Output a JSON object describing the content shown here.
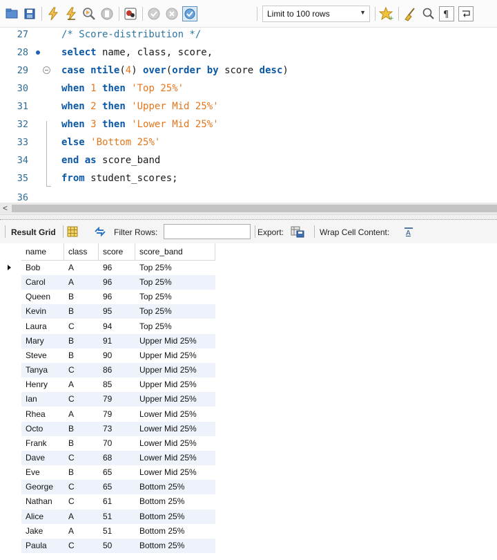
{
  "toolbar": {
    "limit_label": "Limit to 100 rows",
    "icons": [
      "open-folder-icon",
      "save-icon",
      "execute-icon",
      "execute-current-icon",
      "explain-icon",
      "stop-icon",
      "toggle-error-icon",
      "commit-icon",
      "rollback-icon",
      "autocommit-icon",
      "add-snippet-icon",
      "beautify-icon",
      "find-icon",
      "invisible-chars-icon",
      "wrap-icon"
    ]
  },
  "editor": {
    "lines": [
      {
        "num": "27",
        "breakpoint": false,
        "fold": false,
        "tokens": [
          {
            "t": "/* Score-distribution */",
            "c": "c"
          }
        ]
      },
      {
        "num": "28",
        "breakpoint": true,
        "fold": false,
        "tokens": [
          {
            "t": "select",
            "c": "k"
          },
          {
            "t": " name, class, score,",
            "c": "t"
          }
        ]
      },
      {
        "num": "29",
        "breakpoint": false,
        "fold": true,
        "tokens": [
          {
            "t": "case",
            "c": "k"
          },
          {
            "t": " ",
            "c": "t"
          },
          {
            "t": "ntile",
            "c": "k"
          },
          {
            "t": "(",
            "c": "t"
          },
          {
            "t": "4",
            "c": "o"
          },
          {
            "t": ") ",
            "c": "t"
          },
          {
            "t": "over",
            "c": "k"
          },
          {
            "t": "(",
            "c": "t"
          },
          {
            "t": "order by",
            "c": "k"
          },
          {
            "t": " score ",
            "c": "t"
          },
          {
            "t": "desc",
            "c": "k"
          },
          {
            "t": ")",
            "c": "t"
          }
        ]
      },
      {
        "num": "30",
        "breakpoint": false,
        "fold": false,
        "tokens": [
          {
            "t": "when",
            "c": "k"
          },
          {
            "t": " ",
            "c": "t"
          },
          {
            "t": "1",
            "c": "o"
          },
          {
            "t": " ",
            "c": "t"
          },
          {
            "t": "then",
            "c": "k"
          },
          {
            "t": " ",
            "c": "t"
          },
          {
            "t": "'Top 25%'",
            "c": "o"
          }
        ]
      },
      {
        "num": "31",
        "breakpoint": false,
        "fold": false,
        "tokens": [
          {
            "t": "when",
            "c": "k"
          },
          {
            "t": " ",
            "c": "t"
          },
          {
            "t": "2",
            "c": "o"
          },
          {
            "t": " ",
            "c": "t"
          },
          {
            "t": "then",
            "c": "k"
          },
          {
            "t": " ",
            "c": "t"
          },
          {
            "t": "'Upper Mid 25%'",
            "c": "o"
          }
        ]
      },
      {
        "num": "32",
        "breakpoint": false,
        "fold": false,
        "tokens": [
          {
            "t": "when",
            "c": "k"
          },
          {
            "t": " ",
            "c": "t"
          },
          {
            "t": "3",
            "c": "o"
          },
          {
            "t": " ",
            "c": "t"
          },
          {
            "t": "then",
            "c": "k"
          },
          {
            "t": " ",
            "c": "t"
          },
          {
            "t": "'Lower Mid 25%'",
            "c": "o"
          }
        ]
      },
      {
        "num": "33",
        "breakpoint": false,
        "fold": false,
        "tokens": [
          {
            "t": "else",
            "c": "k"
          },
          {
            "t": " ",
            "c": "t"
          },
          {
            "t": "'Bottom 25%'",
            "c": "o"
          }
        ]
      },
      {
        "num": "34",
        "breakpoint": false,
        "fold": false,
        "tokens": [
          {
            "t": "end",
            "c": "k"
          },
          {
            "t": " ",
            "c": "t"
          },
          {
            "t": "as",
            "c": "k"
          },
          {
            "t": " score_band",
            "c": "t"
          }
        ]
      },
      {
        "num": "35",
        "breakpoint": false,
        "fold": false,
        "tokens": [
          {
            "t": "from",
            "c": "k"
          },
          {
            "t": " student_scores;",
            "c": "t"
          }
        ]
      },
      {
        "num": "36",
        "breakpoint": false,
        "fold": false,
        "tokens": []
      }
    ]
  },
  "result_toolbar": {
    "result_grid_label": "Result Grid",
    "filter_label": "Filter Rows:",
    "filter_value": "",
    "export_label": "Export:",
    "wrap_label": "Wrap Cell Content:"
  },
  "grid": {
    "columns": [
      "name",
      "class",
      "score",
      "score_band"
    ],
    "rows": [
      [
        "Bob",
        "A",
        "96",
        "Top 25%"
      ],
      [
        "Carol",
        "A",
        "96",
        "Top 25%"
      ],
      [
        "Queen",
        "B",
        "96",
        "Top 25%"
      ],
      [
        "Kevin",
        "B",
        "95",
        "Top 25%"
      ],
      [
        "Laura",
        "C",
        "94",
        "Top 25%"
      ],
      [
        "Mary",
        "B",
        "91",
        "Upper Mid 25%"
      ],
      [
        "Steve",
        "B",
        "90",
        "Upper Mid 25%"
      ],
      [
        "Tanya",
        "C",
        "86",
        "Upper Mid 25%"
      ],
      [
        "Henry",
        "A",
        "85",
        "Upper Mid 25%"
      ],
      [
        "Ian",
        "C",
        "79",
        "Upper Mid 25%"
      ],
      [
        "Rhea",
        "A",
        "79",
        "Lower Mid 25%"
      ],
      [
        "Octo",
        "B",
        "73",
        "Lower Mid 25%"
      ],
      [
        "Frank",
        "B",
        "70",
        "Lower Mid 25%"
      ],
      [
        "Dave",
        "C",
        "68",
        "Lower Mid 25%"
      ],
      [
        "Eve",
        "B",
        "65",
        "Lower Mid 25%"
      ],
      [
        "George",
        "C",
        "65",
        "Bottom 25%"
      ],
      [
        "Nathan",
        "C",
        "61",
        "Bottom 25%"
      ],
      [
        "Alice",
        "A",
        "51",
        "Bottom 25%"
      ],
      [
        "Jake",
        "A",
        "51",
        "Bottom 25%"
      ],
      [
        "Paula",
        "C",
        "50",
        "Bottom 25%"
      ]
    ]
  },
  "colors": {
    "keyword": "#0a57a5",
    "literal": "#e5761d",
    "comment": "#2e77a5",
    "line_number": "#2c6a92",
    "row_alt": "#eef3fb"
  }
}
